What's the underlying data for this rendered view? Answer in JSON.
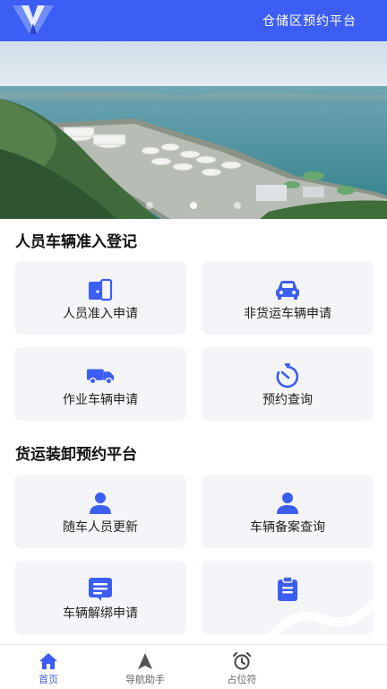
{
  "header": {
    "title": "仓储区预约平台",
    "logo_icon": "v-logo-icon"
  },
  "banner": {
    "slide_count": 3,
    "active_index": 1
  },
  "sections": [
    {
      "title": "人员车辆准入登记",
      "cards": [
        {
          "label": "人员准入申请",
          "icon": "door-icon"
        },
        {
          "label": "非货运车辆申请",
          "icon": "car-icon"
        },
        {
          "label": "作业车辆申请",
          "icon": "truck-icon"
        },
        {
          "label": "预约查询",
          "icon": "timer-icon"
        }
      ]
    },
    {
      "title": "货运装卸预约平台",
      "cards": [
        {
          "label": "随车人员更新",
          "icon": "person-icon"
        },
        {
          "label": "车辆备案查询",
          "icon": "person-icon"
        },
        {
          "label": "车辆解绑申请",
          "icon": "document-icon"
        },
        {
          "label": "",
          "icon": "clipboard-icon"
        }
      ]
    }
  ],
  "tabbar": {
    "tabs": [
      {
        "label": "首页",
        "icon": "home-icon",
        "active": true
      },
      {
        "label": "导航助手",
        "icon": "navigation-icon",
        "active": false
      },
      {
        "label": "占位符",
        "icon": "alarm-clock-icon",
        "active": false
      }
    ]
  },
  "colors": {
    "primary": "#3d5ef5",
    "card_bg": "#f4f5f8"
  }
}
